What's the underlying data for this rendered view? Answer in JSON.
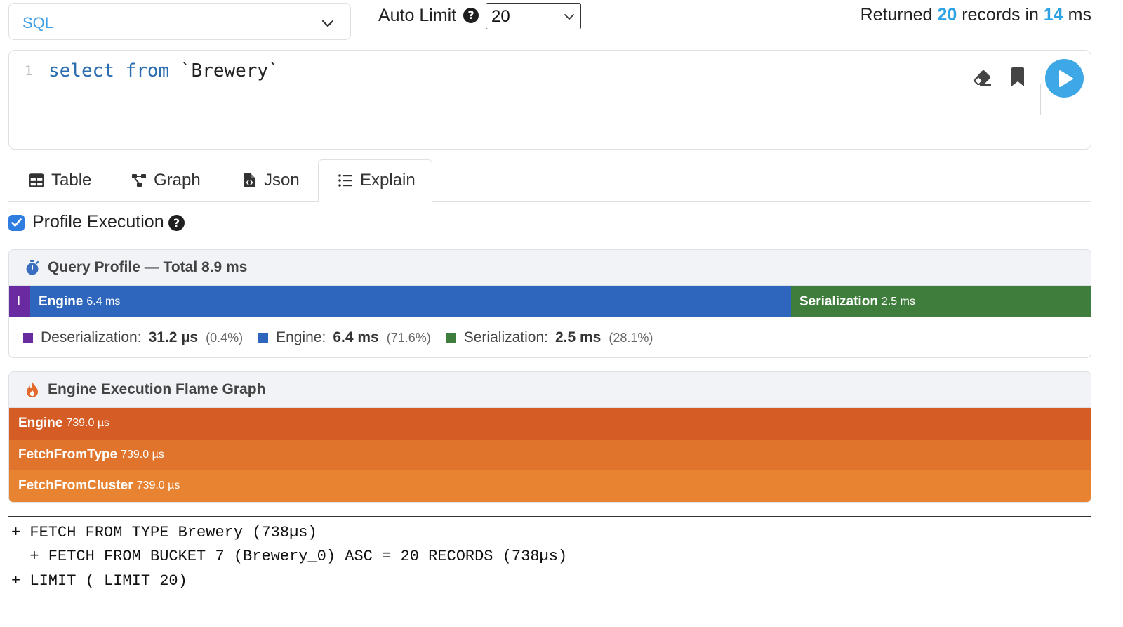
{
  "toolbar": {
    "language": "SQL",
    "auto_limit_label": "Auto Limit",
    "auto_limit_help": "?",
    "auto_limit_value": "20",
    "returned_prefix": "Returned",
    "returned_count": "20",
    "returned_middle": "records in",
    "returned_time": "14",
    "returned_unit": "ms"
  },
  "editor": {
    "line_number": "1",
    "keyword_select": "select",
    "keyword_from": "from",
    "identifier": "`Brewery`"
  },
  "tabs": [
    {
      "label": "Table",
      "icon": "table-icon"
    },
    {
      "label": "Graph",
      "icon": "graph-icon"
    },
    {
      "label": "Json",
      "icon": "json-file-icon"
    },
    {
      "label": "Explain",
      "icon": "list-icon",
      "active": true
    }
  ],
  "profile": {
    "checkbox_label": "Profile Execution",
    "checked": true,
    "help": "?"
  },
  "query_profile": {
    "title": "Query Profile — Total 8.9 ms",
    "bar": {
      "deser_label": "I",
      "engine_name": "Engine",
      "engine_time": "6.4 ms",
      "ser_name": "Serialization",
      "ser_time": "2.5 ms"
    },
    "legend": [
      {
        "name": "Deserialization:",
        "value": "31.2 µs",
        "pct": "(0.4%)",
        "color": "#6a2aa0"
      },
      {
        "name": "Engine:",
        "value": "6.4 ms",
        "pct": "(71.6%)",
        "color": "#2f66bd"
      },
      {
        "name": "Serialization:",
        "value": "2.5 ms",
        "pct": "(28.1%)",
        "color": "#3f7d3c"
      }
    ]
  },
  "flame_graph": {
    "title": "Engine Execution Flame Graph",
    "rows": [
      {
        "name": "Engine",
        "time": "739.0 µs",
        "color": "#d55d25"
      },
      {
        "name": "FetchFromType",
        "time": "739.0 µs",
        "color": "#e0742c"
      },
      {
        "name": "FetchFromCluster",
        "time": "739.0 µs",
        "color": "#e78331"
      }
    ]
  },
  "plan": {
    "lines": [
      "+ FETCH FROM TYPE Brewery (738µs)",
      "  + FETCH FROM BUCKET 7 (Brewery_0) ASC = 20 RECORDS (738µs)",
      "+ LIMIT ( LIMIT 20)"
    ]
  }
}
